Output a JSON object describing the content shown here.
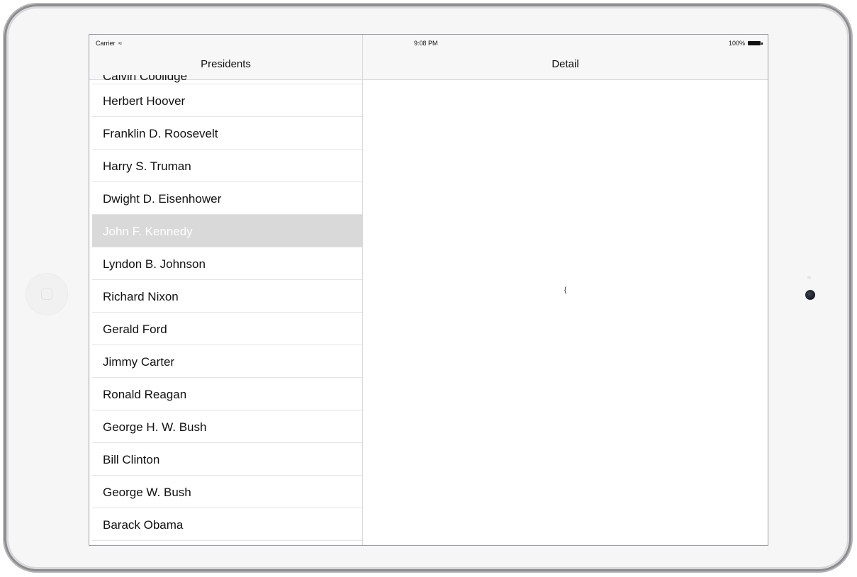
{
  "status_bar": {
    "carrier": "Carrier",
    "time": "9:08 PM",
    "battery": "100%"
  },
  "master": {
    "title": "Presidents",
    "partial_item": "Calvin Coolidge",
    "items": [
      "Herbert Hoover",
      "Franklin D. Roosevelt",
      "Harry S. Truman",
      "Dwight D. Eisenhower",
      "John F. Kennedy",
      "Lyndon B. Johnson",
      "Richard Nixon",
      "Gerald Ford",
      "Jimmy Carter",
      "Ronald Reagan",
      "George H. W. Bush",
      "Bill Clinton",
      "George W. Bush",
      "Barack Obama"
    ],
    "selected_item": "John F. Kennedy"
  },
  "detail": {
    "title": "Detail",
    "body_text": "{"
  },
  "colors": {
    "selected_row_bg": "#d9d9d9",
    "navbar_bg": "#f7f7f8"
  }
}
